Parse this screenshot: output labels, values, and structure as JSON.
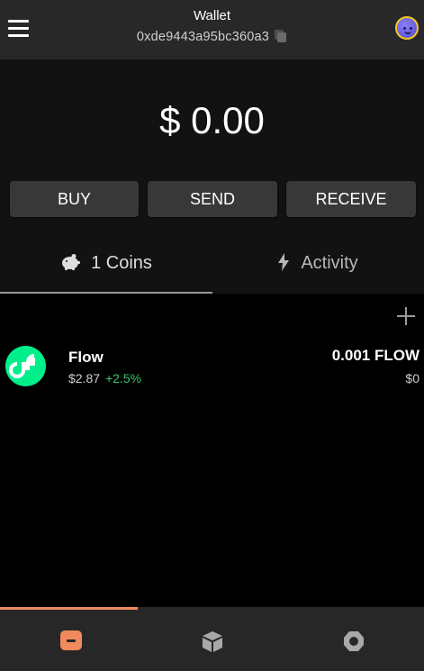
{
  "header": {
    "title": "Wallet",
    "address": "0xde9443a95bc360a3"
  },
  "balance": {
    "display": "$ 0.00"
  },
  "actions": {
    "buy": "BUY",
    "send": "SEND",
    "receive": "RECEIVE"
  },
  "tabs": {
    "coins": "1 Coins",
    "activity": "Activity",
    "active": "coins"
  },
  "coins": [
    {
      "name": "Flow",
      "price": "$2.87",
      "change": "+2.5%",
      "amount": "0.001 FLOW",
      "fiat": "$0",
      "icon": "flow-logo-icon",
      "color": "#00ef8b"
    }
  ],
  "nav": {
    "active": "wallet",
    "items": [
      {
        "name": "wallet",
        "icon": "wallet-icon"
      },
      {
        "name": "nft",
        "icon": "cube-icon"
      },
      {
        "name": "settings",
        "icon": "settings-gear-icon"
      }
    ]
  },
  "colors": {
    "accent": "#f08a5d",
    "positive": "#3cc46a",
    "flow": "#00ef8b",
    "header_bg": "#282828",
    "button_bg": "#383838"
  }
}
